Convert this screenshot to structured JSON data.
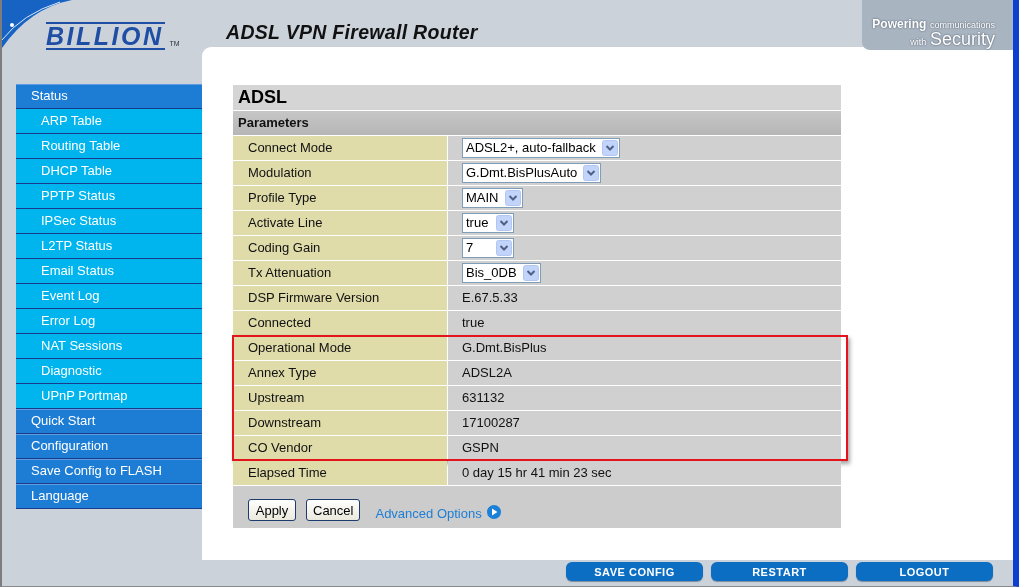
{
  "header": {
    "logo": "BILLION",
    "logo_mark": "TM",
    "title": "ADSL VPN Firewall Router",
    "tagline": [
      [
        {
          "kind": "bold",
          "text": "Powering"
        },
        {
          "kind": "small",
          "text": "communications"
        }
      ],
      [
        {
          "kind": "small",
          "text": "with"
        },
        {
          "kind": "large",
          "text": "Security"
        }
      ]
    ]
  },
  "sidebar": {
    "items": [
      {
        "label": "Status",
        "children": [
          {
            "label": "ARP Table"
          },
          {
            "label": "Routing Table"
          },
          {
            "label": "DHCP Table"
          },
          {
            "label": "PPTP Status"
          },
          {
            "label": "IPSec Status"
          },
          {
            "label": "L2TP Status"
          },
          {
            "label": "Email Status"
          },
          {
            "label": "Event Log"
          },
          {
            "label": "Error Log"
          },
          {
            "label": "NAT Sessions"
          },
          {
            "label": "Diagnostic"
          },
          {
            "label": "UPnP Portmap"
          }
        ]
      },
      {
        "label": "Quick Start"
      },
      {
        "label": "Configuration"
      },
      {
        "label": "Save Config to FLASH"
      },
      {
        "label": "Language"
      }
    ]
  },
  "panel": {
    "title": "ADSL",
    "section": "Parameters",
    "rows": [
      {
        "kind": "select",
        "label": "Connect Mode",
        "value": "ADSL2+, auto-fallback",
        "highlighted": false
      },
      {
        "kind": "select",
        "label": "Modulation",
        "value": "G.Dmt.BisPlusAuto",
        "highlighted": false
      },
      {
        "kind": "select",
        "label": "Profile Type",
        "value": "MAIN",
        "highlighted": false
      },
      {
        "kind": "select",
        "label": "Activate Line",
        "value": "true",
        "highlighted": false
      },
      {
        "kind": "select",
        "label": "Coding Gain",
        "value": "7",
        "highlighted": false
      },
      {
        "kind": "select",
        "label": "Tx Attenuation",
        "value": "Bis_0DB",
        "highlighted": false
      },
      {
        "kind": "text",
        "label": "DSP Firmware Version",
        "value": "E.67.5.33",
        "highlighted": false
      },
      {
        "kind": "text",
        "label": "Connected",
        "value": "true",
        "highlighted": false
      },
      {
        "kind": "text",
        "label": "Operational Mode",
        "value": "G.Dmt.BisPlus",
        "highlighted": true
      },
      {
        "kind": "text",
        "label": "Annex Type",
        "value": "ADSL2A",
        "highlighted": true
      },
      {
        "kind": "text",
        "label": "Upstream",
        "value": "631132",
        "highlighted": true
      },
      {
        "kind": "text",
        "label": "Downstream",
        "value": "17100287",
        "highlighted": true
      },
      {
        "kind": "text",
        "label": "CO Vendor",
        "value": "GSPN",
        "highlighted": true
      },
      {
        "kind": "text",
        "label": "Elapsed Time",
        "value": "0 day 15 hr 41 min 23 sec",
        "highlighted": false
      }
    ],
    "buttons": [
      "Apply",
      "Cancel"
    ],
    "link": "Advanced Options"
  },
  "footer_buttons": [
    "SAVE CONFIG",
    "RESTART",
    "LOGOUT"
  ]
}
